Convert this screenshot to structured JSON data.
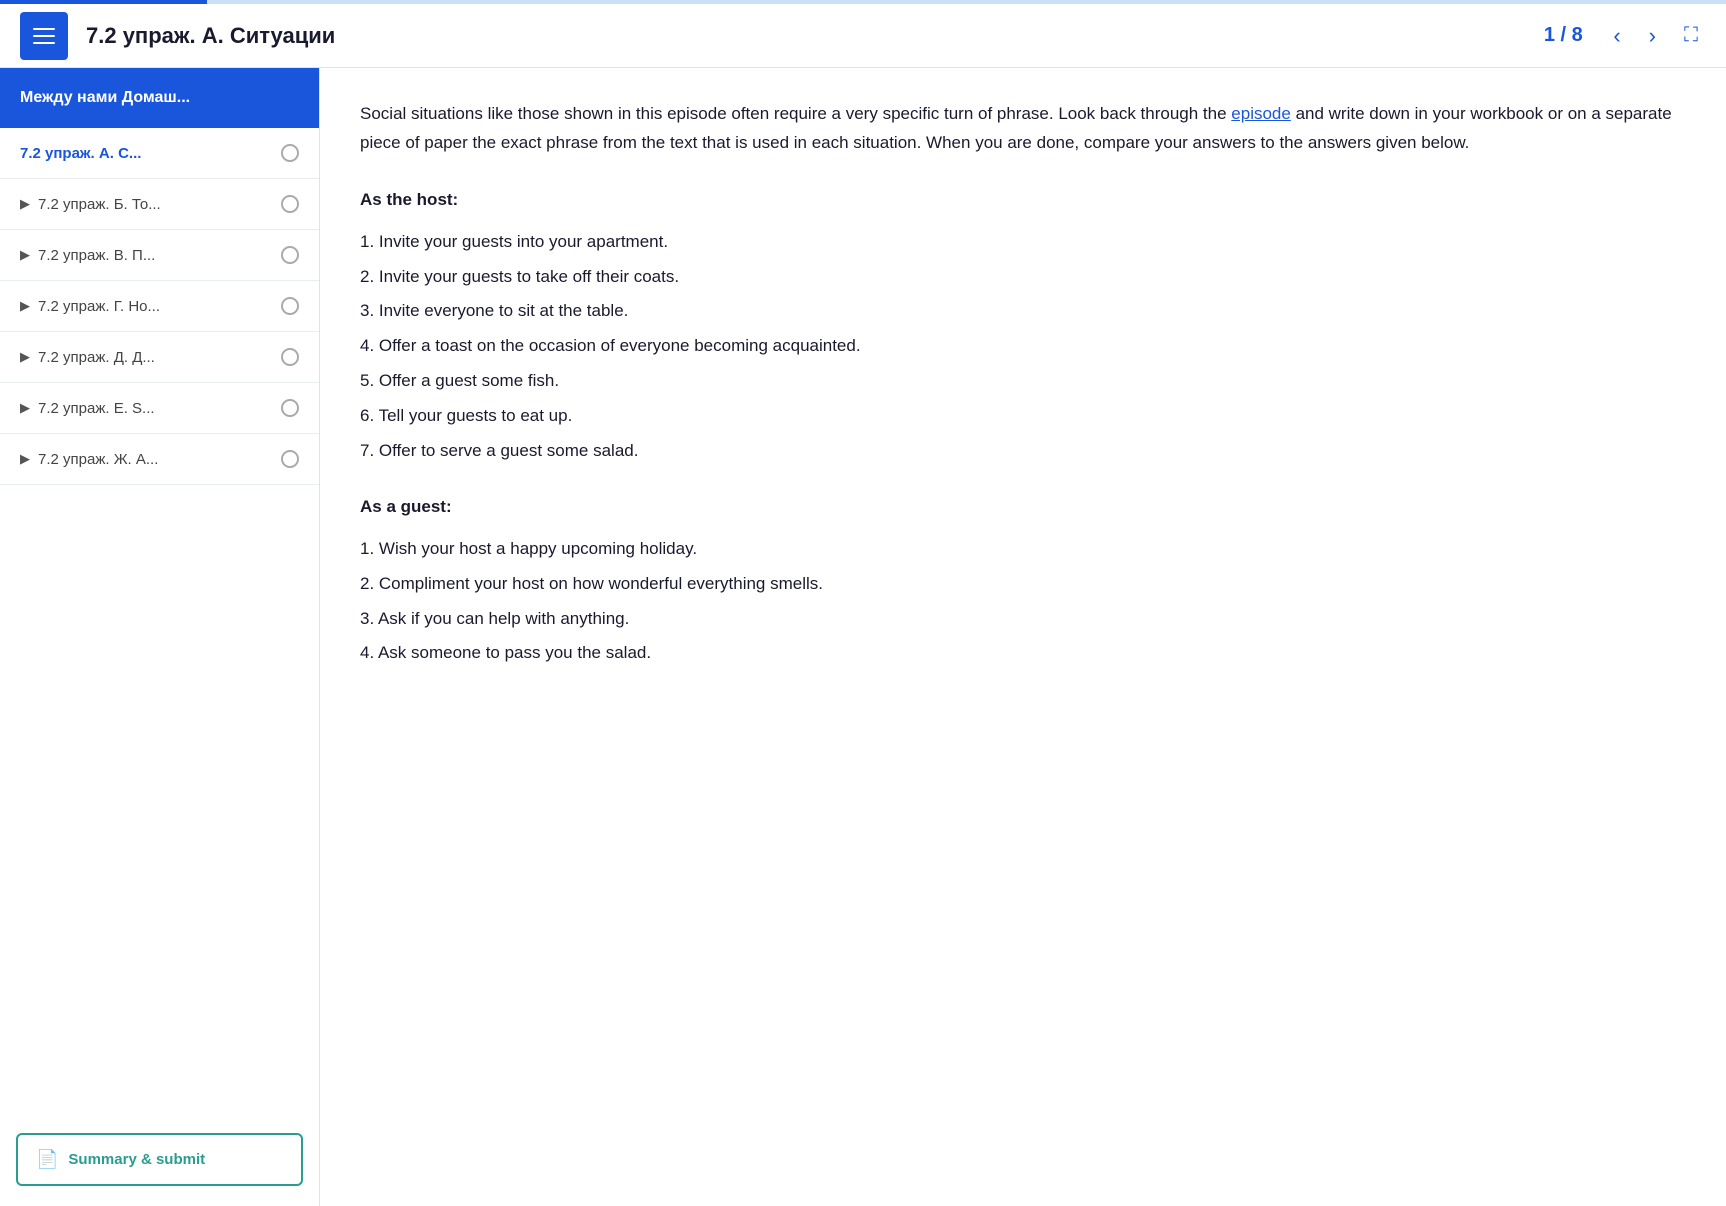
{
  "progress": {
    "percent": 12
  },
  "header": {
    "title": "7.2 упраж. А. Ситуации",
    "page_current": "1",
    "page_total": "8",
    "page_display": "1 / 8"
  },
  "sidebar": {
    "header_label": "Между нами Домаш...",
    "items": [
      {
        "id": "item-a",
        "label": "7.2 упраж. А. С...",
        "active": true,
        "has_arrow": false
      },
      {
        "id": "item-b",
        "label": "7.2 упраж. Б. То...",
        "active": false,
        "has_arrow": true
      },
      {
        "id": "item-c",
        "label": "7.2 упраж. В. П...",
        "active": false,
        "has_arrow": true
      },
      {
        "id": "item-d",
        "label": "7.2 упраж. Г. Но...",
        "active": false,
        "has_arrow": true
      },
      {
        "id": "item-e",
        "label": "7.2 упраж. Д. Д...",
        "active": false,
        "has_arrow": true
      },
      {
        "id": "item-f",
        "label": "7.2 упраж. Е. S...",
        "active": false,
        "has_arrow": true
      },
      {
        "id": "item-g",
        "label": "7.2 упраж. Ж. А...",
        "active": false,
        "has_arrow": true
      }
    ],
    "summary_label": "Summary & submit"
  },
  "content": {
    "intro": "Social situations like those shown in this episode often require a very specific turn of phrase. Look back through the ",
    "link_text": "episode",
    "intro_after": " and write down in your workbook or on a separate piece of paper the exact phrase from the text that is used in each situation. When you are done, compare your answers to the answers given below.",
    "host_title": "As the host:",
    "host_items": [
      "Invite your guests into your apartment.",
      "Invite your guests to take off their coats.",
      "Invite everyone to sit at the table.",
      "Offer a toast on the occasion of everyone becoming acquainted.",
      "Offer a guest some fish.",
      "Tell your guests to eat up.",
      "Offer to serve a guest some salad."
    ],
    "guest_title": "As a guest:",
    "guest_items": [
      "Wish your host a happy upcoming holiday.",
      "Compliment your host on how wonderful everything smells.",
      "Ask if you can help with anything.",
      "Ask someone to pass you the salad."
    ]
  }
}
